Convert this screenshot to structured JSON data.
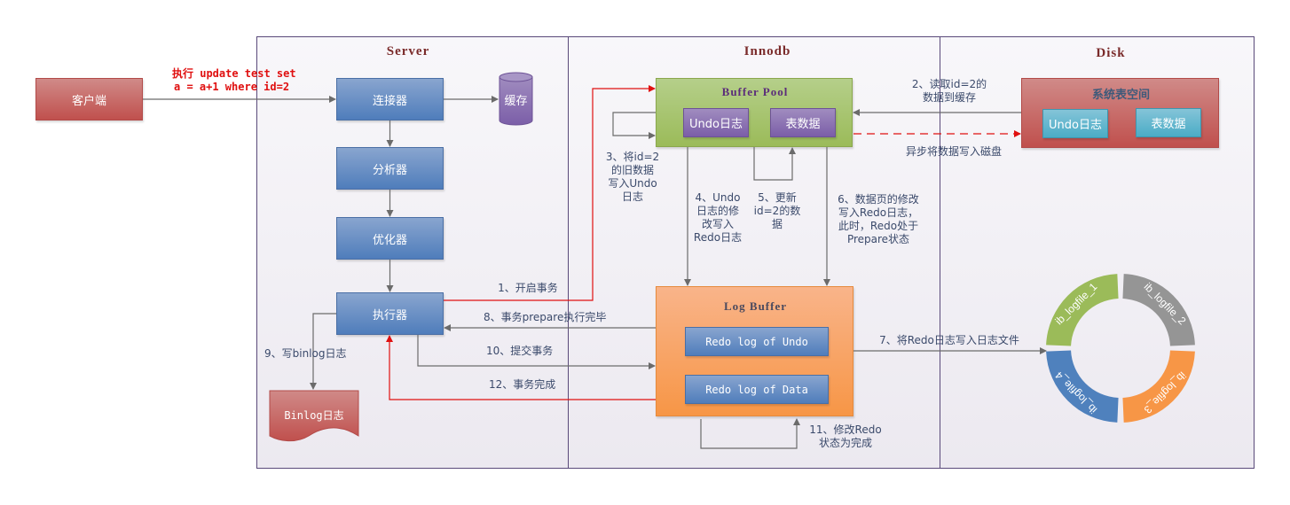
{
  "lanes": {
    "server": "Server",
    "innodb": "Innodb",
    "disk": "Disk"
  },
  "client": {
    "label": "客户端"
  },
  "sql_statement": {
    "line1": "执行 update test set",
    "line2": "a = a+1 where id=2"
  },
  "server": {
    "connector": "连接器",
    "analyzer": "分析器",
    "optimizer": "优化器",
    "executor": "执行器",
    "cache": "缓存",
    "binlog": "Binlog日志"
  },
  "buffer_pool": {
    "title": "Buffer Pool",
    "undo": "Undo日志",
    "table_data": "表数据"
  },
  "log_buffer": {
    "title": "Log Buffer",
    "redo_undo": "Redo log of Undo",
    "redo_data": "Redo log of Data"
  },
  "system_tablespace": {
    "title": "系统表空间",
    "undo": "Undo日志",
    "table_data": "表数据"
  },
  "logfiles": [
    {
      "name": "ib_logfile_1",
      "color": "#9bbb59"
    },
    {
      "name": "ib_logfile_2",
      "color": "#959595"
    },
    {
      "name": "ib_logfile_3",
      "color": "#f79646"
    },
    {
      "name": "ib_logfile_4",
      "color": "#4f81bd"
    }
  ],
  "steps": {
    "s1": "1、开启事务",
    "s2": "2、读取id=2的\n数据到缓存",
    "s3": "3、将id=2\n的旧数据\n写入Undo\n日志",
    "s4": "4、Undo\n日志的修\n改写入\nRedo日志",
    "s5": "5、更新\nid=2的数\n据",
    "s6": "6、数据页的修改\n写入Redo日志，\n此时，Redo处于\nPrepare状态",
    "s7": "7、将Redo日志写入日志文件",
    "s8": "8、事务prepare执行完毕",
    "s9": "9、写binlog日志",
    "s10": "10、提交事务",
    "s11": "11、修改Redo\n状态为完成",
    "s12": "12、事务完成",
    "async": "异步将数据写入磁盘"
  },
  "colors": {
    "red_flow": "#e01010",
    "gray_flow": "#6b6b6b"
  }
}
